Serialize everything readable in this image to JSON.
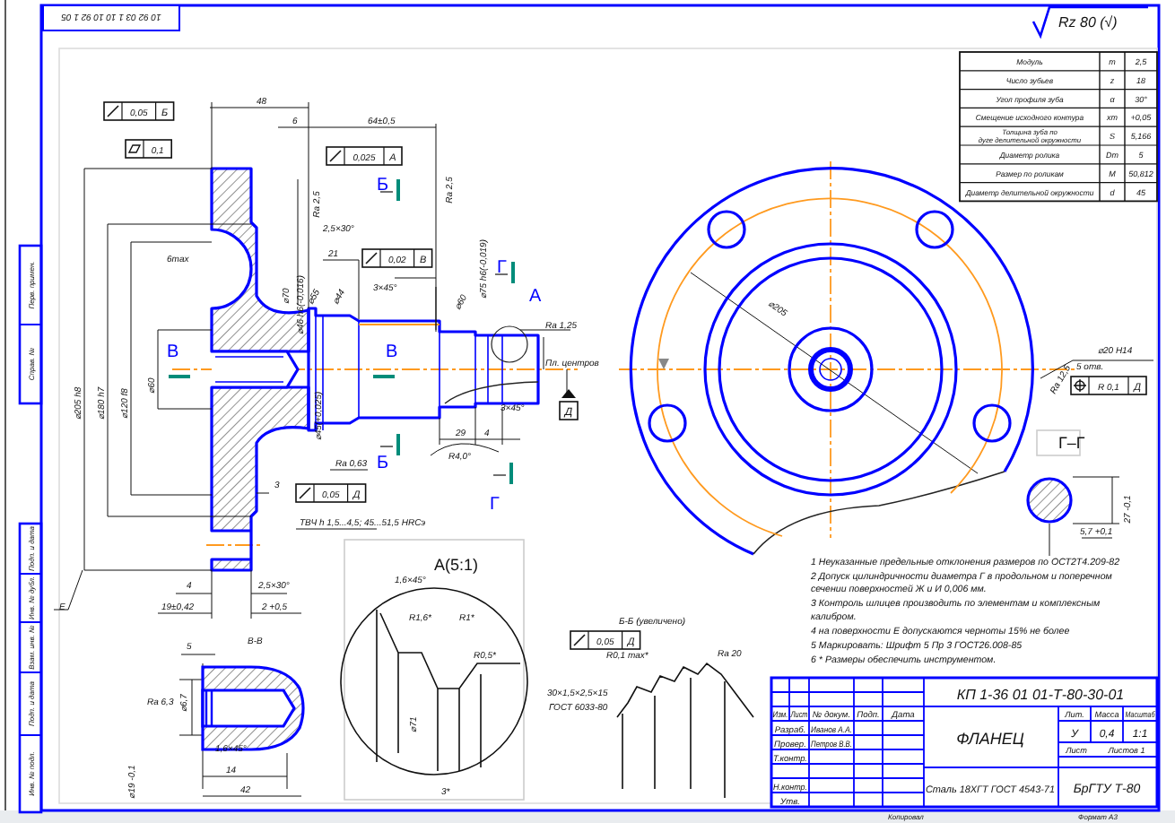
{
  "stamp_code": "10 92 03 1 10 10 92 1 05",
  "side_strip_labels": [
    "Перв. примен.",
    "Справ. №",
    "Подп. и дата",
    "Инв. № дубл.",
    "Взам. инв. №",
    "Подп. и дата",
    "Инв. № подл."
  ],
  "roughness_mark": "Rz 80 (√)",
  "gear_table": [
    {
      "parameter": "Модуль",
      "symbol": "m",
      "value": "2,5"
    },
    {
      "parameter": "Число зубьев",
      "symbol": "z",
      "value": "18"
    },
    {
      "parameter": "Угол профиля зуба",
      "symbol": "α",
      "value": "30°"
    },
    {
      "parameter": "Смещение исходного контура",
      "symbol": "xm",
      "value": "+0,05"
    },
    {
      "parameter": "Толщина зуба по дуге делительной окружности",
      "symbol": "S",
      "value": "5,166"
    },
    {
      "parameter": "Диаметр ролика",
      "symbol": "Dm",
      "value": "5"
    },
    {
      "parameter": "Размер по роликам",
      "symbol": "M",
      "value": "50,812"
    },
    {
      "parameter": "Диаметр делительной окружности",
      "symbol": "d",
      "value": "45"
    }
  ],
  "tolerance_frames": [
    {
      "kind": "runout",
      "value": "0,05",
      "datum": "Б"
    },
    {
      "kind": "flatness",
      "value": "0,1"
    },
    {
      "kind": "runout",
      "value": "0,025",
      "datum": "А"
    },
    {
      "kind": "runout",
      "value": "0,02",
      "datum": "В"
    },
    {
      "kind": "runout",
      "value": "0,05",
      "datum": "Д"
    },
    {
      "kind": "runout",
      "value": "0,05",
      "datum": "Д"
    },
    {
      "kind": "position",
      "value": "R 0,1",
      "datum": "Д"
    }
  ],
  "datum_boxes": [
    "Д"
  ],
  "labels": [
    {
      "text": "48",
      "kind": "dim"
    },
    {
      "text": "6",
      "kind": "dim"
    },
    {
      "text": "64±0,5",
      "kind": "dim"
    },
    {
      "text": "Ra 2,5",
      "kind": "dim"
    },
    {
      "text": "Ra 2,5",
      "kind": "dim"
    },
    {
      "text": "2,5×30°",
      "kind": "dim"
    },
    {
      "text": "6max",
      "kind": "dim"
    },
    {
      "text": "21",
      "kind": "dim"
    },
    {
      "text": "3×45°",
      "kind": "dim"
    },
    {
      "text": "⌀75 h6(-0,019)",
      "kind": "dim"
    },
    {
      "text": "⌀55",
      "kind": "dim"
    },
    {
      "text": "⌀44",
      "kind": "dim"
    },
    {
      "text": "⌀70",
      "kind": "dim"
    },
    {
      "text": "⌀46 h6(-0,016)",
      "kind": "dim"
    },
    {
      "text": "⌀60",
      "kind": "dim"
    },
    {
      "text": "⌀205 h8",
      "kind": "dim"
    },
    {
      "text": "⌀180 h7",
      "kind": "dim"
    },
    {
      "text": "⌀120 f8",
      "kind": "dim"
    },
    {
      "text": "⌀60",
      "kind": "dim"
    },
    {
      "text": "⌀45(+0,025)",
      "kind": "dim"
    },
    {
      "text": "В",
      "kind": "letter"
    },
    {
      "text": "В",
      "kind": "letter"
    },
    {
      "text": "Б",
      "kind": "letter"
    },
    {
      "text": "Г",
      "kind": "letter"
    },
    {
      "text": "А",
      "kind": "letter"
    },
    {
      "text": "Б",
      "kind": "letter"
    },
    {
      "text": "Г",
      "kind": "letter"
    },
    {
      "text": "Ra 1,25",
      "kind": "dim"
    },
    {
      "text": "Пл. центров",
      "kind": "dim"
    },
    {
      "text": "29",
      "kind": "dim"
    },
    {
      "text": "4",
      "kind": "dim"
    },
    {
      "text": "3×45°",
      "kind": "dim"
    },
    {
      "text": "R4,0°",
      "kind": "dim"
    },
    {
      "text": "Ra 0,63",
      "kind": "dim"
    },
    {
      "text": "3",
      "kind": "dim"
    },
    {
      "text": "ТВЧ h 1,5...4,5; 45...51,5 HRCэ",
      "kind": "dim"
    },
    {
      "text": "Е",
      "kind": "dim"
    },
    {
      "text": "4",
      "kind": "dim"
    },
    {
      "text": "19±0,42",
      "kind": "dim"
    },
    {
      "text": "2,5×30°",
      "kind": "dim"
    },
    {
      "text": "2 +0,5",
      "kind": "dim"
    },
    {
      "text": "В-В",
      "kind": "dim"
    },
    {
      "text": "5",
      "kind": "dim"
    },
    {
      "text": "⌀6,7",
      "kind": "dim"
    },
    {
      "text": "Ra 6,3",
      "kind": "dim"
    },
    {
      "text": "⌀19 -0,1",
      "kind": "dim"
    },
    {
      "text": "1,6×45°",
      "kind": "dim"
    },
    {
      "text": "14",
      "kind": "dim"
    },
    {
      "text": "42",
      "kind": "dim"
    },
    {
      "text": "А(5:1)",
      "kind": "title"
    },
    {
      "text": "1,6×45°",
      "kind": "dim"
    },
    {
      "text": "R1,6*",
      "kind": "dim"
    },
    {
      "text": "R1*",
      "kind": "dim"
    },
    {
      "text": "R0,5*",
      "kind": "dim"
    },
    {
      "text": "⌀71",
      "kind": "dim"
    },
    {
      "text": "3*",
      "kind": "dim"
    },
    {
      "text": "Б-Б (увеличено)",
      "kind": "dim"
    },
    {
      "text": "30×1,5×2,5×15",
      "kind": "dim"
    },
    {
      "text": "ГОСТ 6033-80",
      "kind": "dim"
    },
    {
      "text": "R0,1 max*",
      "kind": "dim"
    },
    {
      "text": "Ra 20",
      "kind": "dim"
    },
    {
      "text": "⌀205",
      "kind": "dim"
    },
    {
      "text": "⌀20 Н14",
      "kind": "dim"
    },
    {
      "text": "5 отв.",
      "kind": "dim"
    },
    {
      "text": "Ra 12,5",
      "kind": "dim"
    },
    {
      "text": "Г–Г",
      "kind": "title"
    },
    {
      "text": "27 -0,1",
      "kind": "dim"
    },
    {
      "text": "5,7 +0,1",
      "kind": "dim"
    }
  ],
  "notes": [
    {
      "lines": [
        "1 Неуказанные предельные отклонения размеров по ОСТ2Т4.209-82"
      ]
    },
    {
      "lines": [
        "2 Допуск цилиндричности диаметра Г в продольном и поперечном",
        "сечении поверхностей Ж и И 0,006 мм."
      ]
    },
    {
      "lines": [
        "3 Контроль шлицев производить по элементам и комплексным",
        "калибром."
      ]
    },
    {
      "lines": [
        "4 на поверхности Е допускаются черноты 15% не более"
      ]
    },
    {
      "lines": [
        "5 Маркировать: Шрифт 5 Пр 3 ГОСТ26.008-85"
      ]
    },
    {
      "lines": [
        "6 * Размеры обеспечить инструментом."
      ]
    }
  ],
  "title_block": {
    "designation": "КП 1-36 01 01-Т-80-30-01",
    "name": "ФЛАНЕЦ",
    "material": "Сталь 18ХГТ ГОСТ 4543-71",
    "organization": "БрГТУ Т-80",
    "header_cells": [
      "Изм.",
      "Лист",
      "№ докум.",
      "Подп.",
      "Дата"
    ],
    "role_cells": [
      "Разраб.",
      "Провер.",
      "Т.контр.",
      "Н.контр.",
      "Утв."
    ],
    "person_cells": [
      "Иванов А.А.",
      "Петров В.В."
    ],
    "right_headers": [
      "Лит.",
      "Масса",
      "Масштаб"
    ],
    "right_values": [
      "У",
      "0,4",
      "1:1"
    ],
    "sheet_cells": [
      "Лист",
      "Листов 1"
    ]
  },
  "footer": [
    "Копировал",
    "Формат А3"
  ]
}
